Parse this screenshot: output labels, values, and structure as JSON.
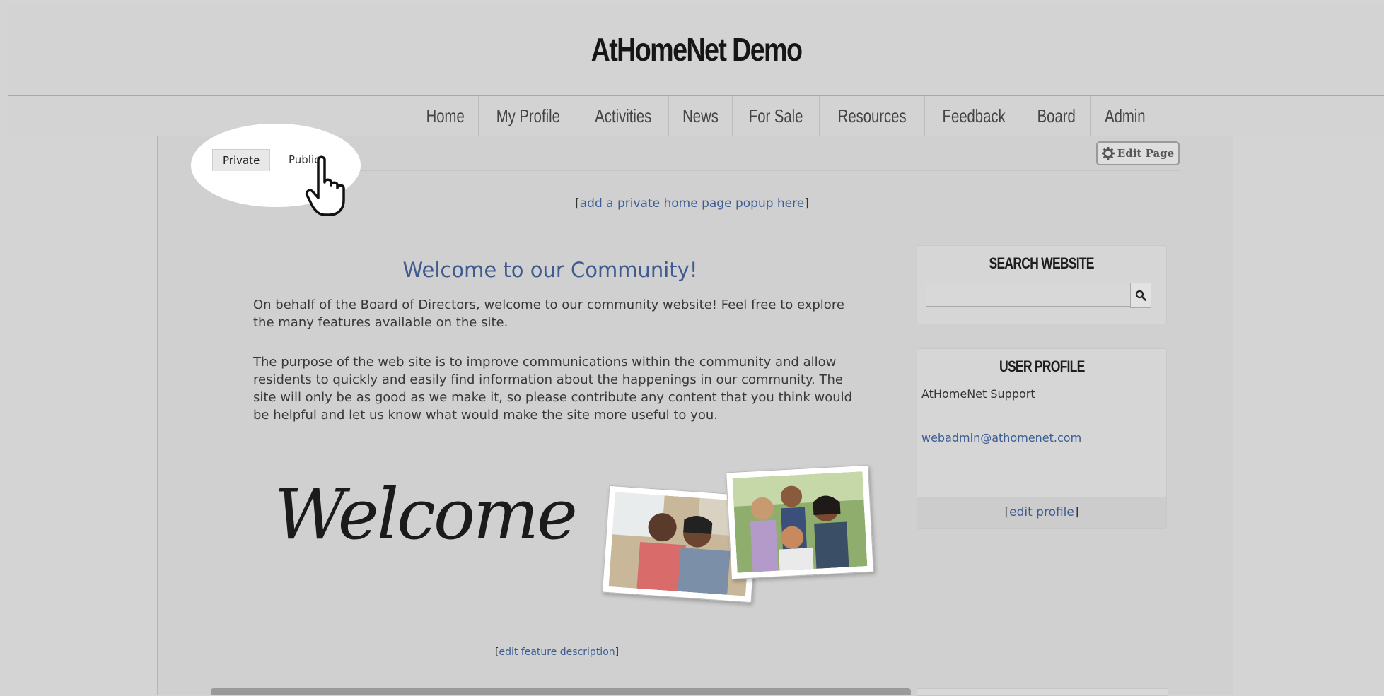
{
  "site": {
    "title": "AtHomeNet Demo"
  },
  "nav": {
    "items": [
      "Home",
      "My Profile",
      "Activities",
      "News",
      "For Sale",
      "Resources",
      "Feedback",
      "Board",
      "Admin"
    ]
  },
  "tabs": {
    "private": "Private",
    "public": "Public"
  },
  "edit_page": {
    "label": "Edit Page",
    "icon": "gear-icon"
  },
  "popup_link": {
    "open": "[",
    "text": "add a private home page popup here",
    "close": "]"
  },
  "main": {
    "welcome_title": "Welcome to our Community!",
    "paragraph1": "On behalf of the Board of Directors, welcome to our community website! Feel free to explore the many features available on the site.",
    "paragraph2": "The purpose of the web site is to improve communications within the community and allow residents to quickly and easily find information about the happenings in our community.  The site will only be as good as we make it, so please contribute any content that you think would be helpful and let us know what would make the site more useful to you.",
    "welcome_script": "Welcome",
    "edit_feature": {
      "open": "[",
      "text": "edit feature description",
      "close": "]"
    }
  },
  "search_widget": {
    "title": "SEARCH WEBSITE",
    "placeholder": "",
    "icon": "search-icon"
  },
  "profile_widget": {
    "title": "USER PROFILE",
    "name": "AtHomeNet Support",
    "email": "webadmin@athomenet.com",
    "edit": {
      "open": "[",
      "text": "edit profile",
      "close": "]"
    }
  },
  "colors": {
    "link": "#3b5d95",
    "title": "#3e5a8e",
    "background": "#d4d4d4"
  }
}
